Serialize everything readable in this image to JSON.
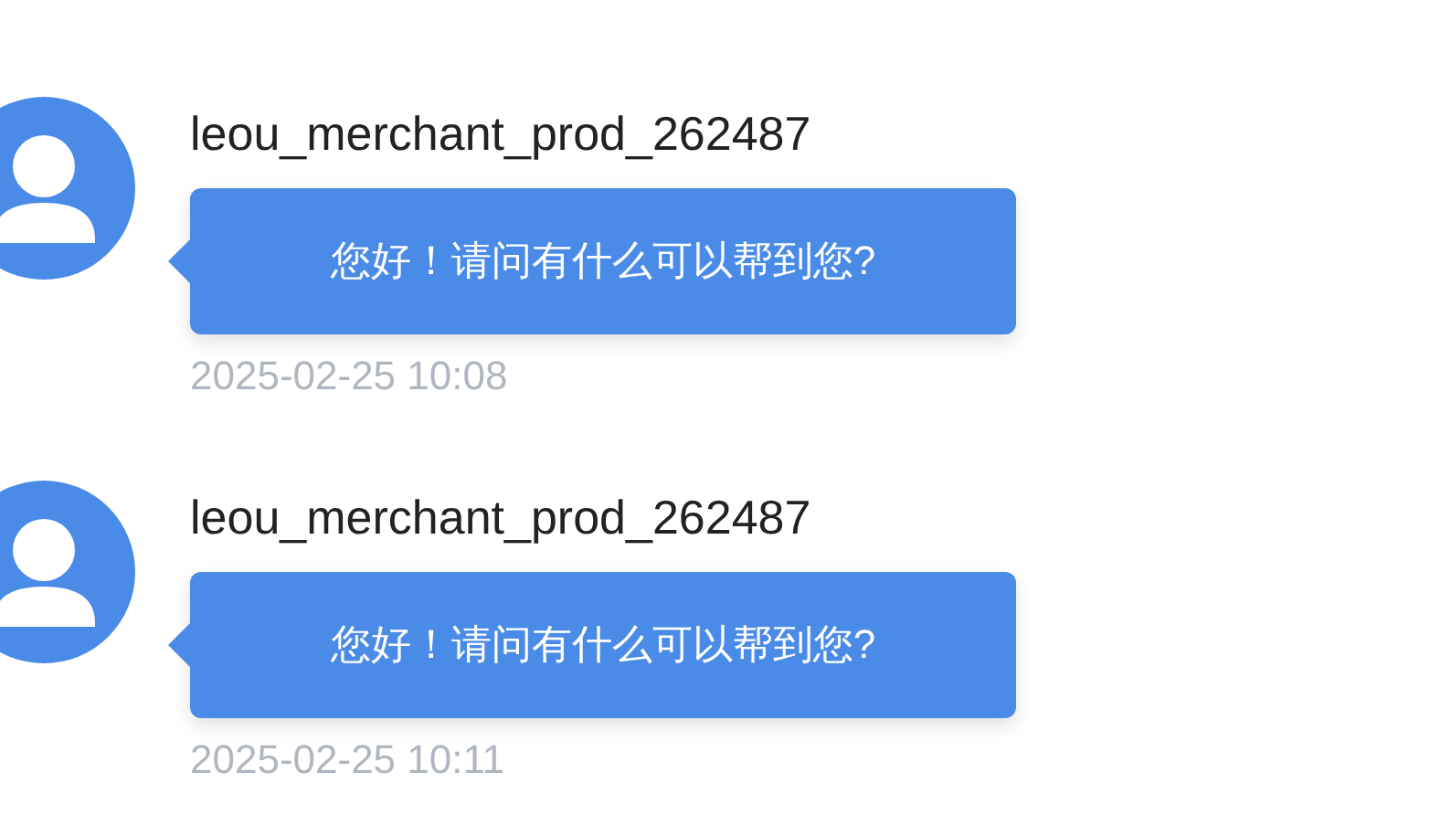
{
  "messages": [
    {
      "sender": "leou_merchant_prod_262487",
      "text": "您好！请问有什么可以帮到您?",
      "time": "2025-02-25 10:08"
    },
    {
      "sender": "leou_merchant_prod_262487",
      "text": "您好！请问有什么可以帮到您?",
      "time": "2025-02-25 10:11"
    }
  ]
}
